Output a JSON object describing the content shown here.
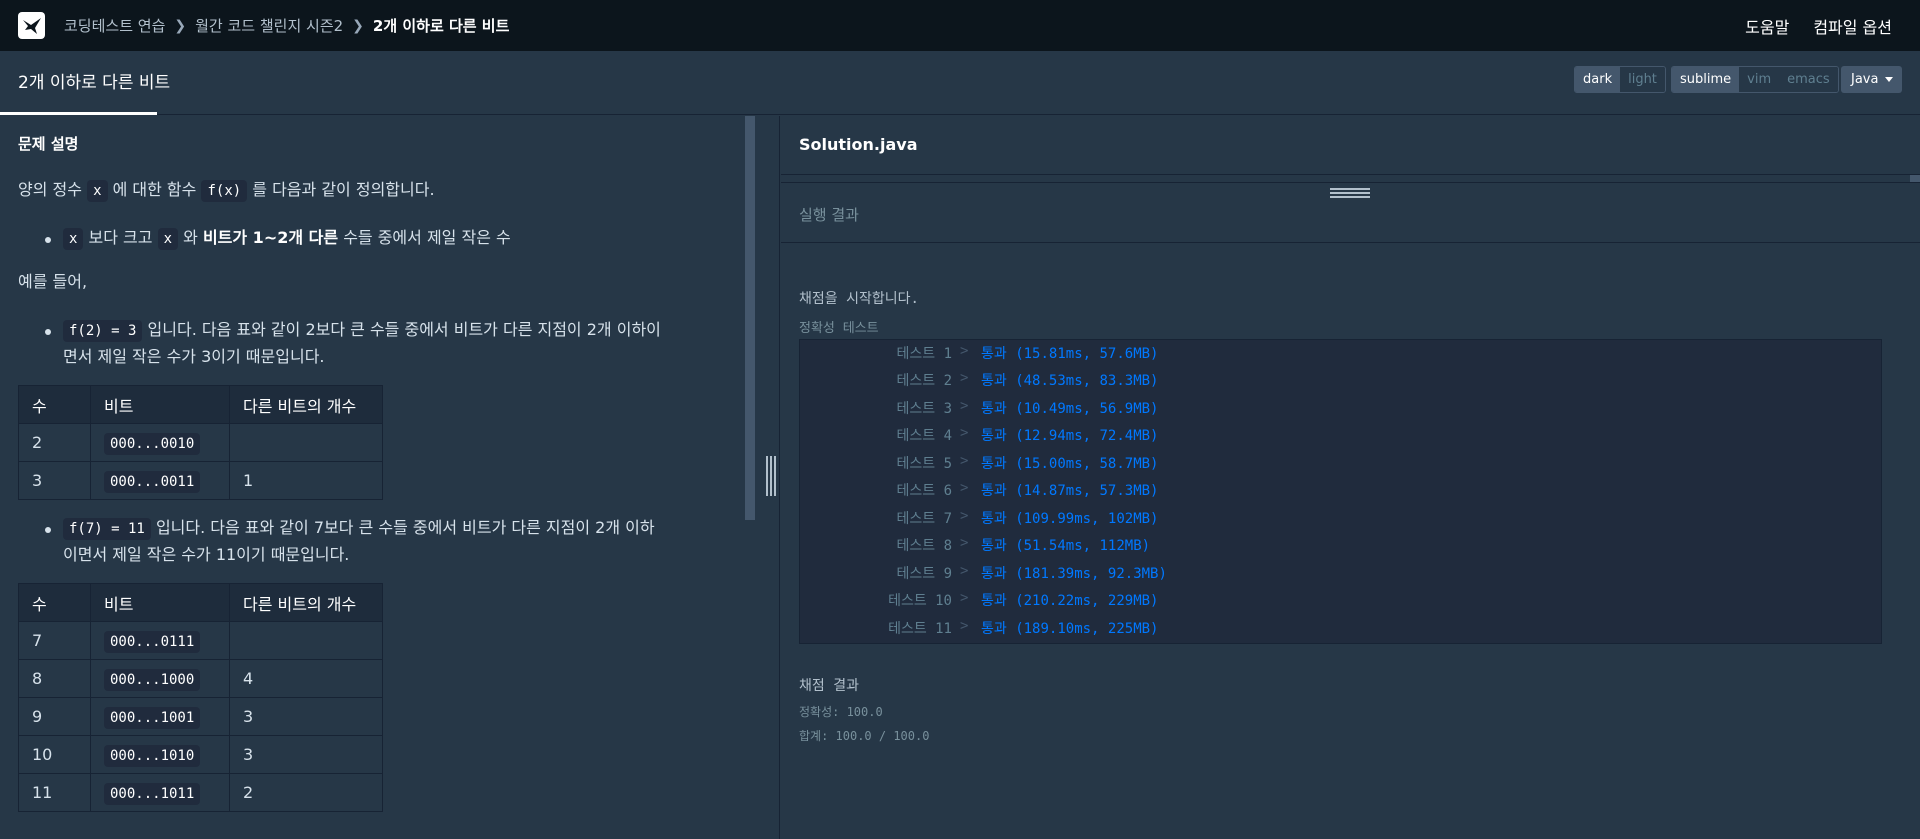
{
  "nav": {
    "breadcrumbs": [
      "코딩테스트 연습",
      "월간 코드 챌린지 시즌2"
    ],
    "current": "2개 이하로 다른 비트",
    "right_links": [
      "도움말",
      "컴파일 옵션"
    ]
  },
  "tabbar": {
    "tab_title": "2개 이하로 다른 비트",
    "theme_options": [
      "dark",
      "light"
    ],
    "theme_selected": "dark",
    "keymap_options": [
      "sublime",
      "vim",
      "emacs"
    ],
    "keymap_selected": "sublime",
    "language": "Java"
  },
  "problem": {
    "heading": "문제 설명",
    "intro_prefix": "양의 정수",
    "intro_x": "x",
    "intro_mid": "에 대한 함수",
    "intro_fx": "f(x)",
    "intro_suffix": "를 다음과 같이 정의합니다.",
    "rule_x1": "x",
    "rule_t1": "보다 크고",
    "rule_x2": "x",
    "rule_t2": "와",
    "rule_bold": "비트가 1~2개 다른",
    "rule_t3": "수들 중에서 제일 작은 수",
    "example_intro": "예를 들어,",
    "ex1_code": "f(2) = 3",
    "ex1_line1": "입니다. 다음 표와 같이 2보다 큰 수들 중에서 비트가 다른 지점이 2개 이하이",
    "ex1_line2": "면서 제일 작은 수가 3이기 때문입니다.",
    "table_headers": [
      "수",
      "비트",
      "다른 비트의 개수"
    ],
    "table1_rows": [
      {
        "num": "2",
        "bits": "000...0010",
        "diff": ""
      },
      {
        "num": "3",
        "bits": "000...0011",
        "diff": "1"
      }
    ],
    "ex2_code": "f(7) = 11",
    "ex2_line1": "입니다. 다음 표와 같이 7보다 큰 수들 중에서 비트가 다른 지점이 2개 이하",
    "ex2_line2": "이면서 제일 작은 수가 11이기 때문입니다.",
    "table2_rows": [
      {
        "num": "7",
        "bits": "000...0111",
        "diff": ""
      },
      {
        "num": "8",
        "bits": "000...1000",
        "diff": "4"
      },
      {
        "num": "9",
        "bits": "000...1001",
        "diff": "3"
      },
      {
        "num": "10",
        "bits": "000...1010",
        "diff": "3"
      },
      {
        "num": "11",
        "bits": "000...1011",
        "diff": "2"
      }
    ]
  },
  "editor": {
    "file_name": "Solution.java",
    "result_title": "실행 결과",
    "start_message": "채점을 시작합니다.",
    "section_label": "정확성  테스트",
    "tests": [
      {
        "name": "테스트 1",
        "result": "통과 (15.81ms, 57.6MB)"
      },
      {
        "name": "테스트 2",
        "result": "통과 (48.53ms, 83.3MB)"
      },
      {
        "name": "테스트 3",
        "result": "통과 (10.49ms, 56.9MB)"
      },
      {
        "name": "테스트 4",
        "result": "통과 (12.94ms, 72.4MB)"
      },
      {
        "name": "테스트 5",
        "result": "통과 (15.00ms, 58.7MB)"
      },
      {
        "name": "테스트 6",
        "result": "통과 (14.87ms, 57.3MB)"
      },
      {
        "name": "테스트 7",
        "result": "통과 (109.99ms, 102MB)"
      },
      {
        "name": "테스트 8",
        "result": "통과 (51.54ms, 112MB)"
      },
      {
        "name": "테스트 9",
        "result": "통과 (181.39ms, 92.3MB)"
      },
      {
        "name": "테스트 10",
        "result": "통과 (210.22ms, 229MB)"
      },
      {
        "name": "테스트 11",
        "result": "통과 (189.10ms, 225MB)"
      }
    ],
    "final_label": "채점 결과",
    "accuracy": "정확성: 100.0",
    "total": "합계: 100.0 / 100.0"
  },
  "colors": {
    "background": "#263747",
    "topbar": "#0c151c",
    "pass": "#0078ff"
  }
}
